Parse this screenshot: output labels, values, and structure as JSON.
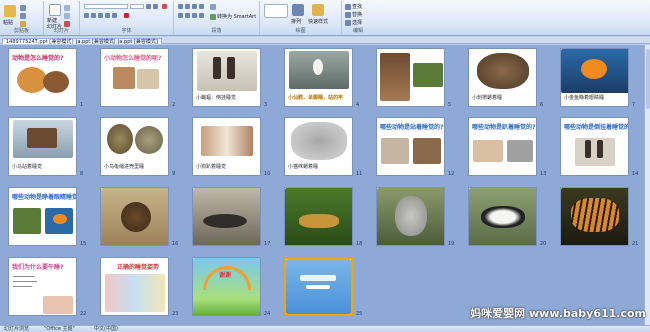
{
  "ribbon": {
    "paste_label": "粘贴",
    "clipboard_group": "剪贴板",
    "new_slide_label": "新建",
    "new_slide_sub": "幻灯片",
    "slides_group": "幻灯片",
    "font_group": "字体",
    "paragraph_group": "段落",
    "drawing_group": "绘图",
    "arrange_label": "排列",
    "quick_styles_label": "快速样式",
    "find_label": "查找",
    "replace_label": "替换",
    "select_label": "选择",
    "editing_group": "编辑",
    "smartart_label": "转换为 SmartArt"
  },
  "tabs": [
    {
      "label": "1489775247.ppt [兼容模式]",
      "selected": true
    },
    {
      "label": "ja.ppt [兼容模式]",
      "selected": false
    },
    {
      "label": "ja.ppt [兼容模式]",
      "selected": false
    }
  ],
  "slides": [
    {
      "num": "1",
      "title": "动物是怎么睡觉的?",
      "caption": ""
    },
    {
      "num": "2",
      "title": "小动物怎么睡觉的呢?",
      "caption": ""
    },
    {
      "num": "3",
      "title": "",
      "caption": "小蝙蝠：倒挂睡觉"
    },
    {
      "num": "4",
      "title": "",
      "caption": "小仙鹤，单脚睡，站的牢"
    },
    {
      "num": "5",
      "title": "",
      "caption": ""
    },
    {
      "num": "6",
      "title": "",
      "caption": "小刺猬蜷着睡"
    },
    {
      "num": "7",
      "title": "",
      "caption": "小金鱼睁着眼睛睡"
    },
    {
      "num": "8",
      "title": "",
      "caption": "小马站着睡觉"
    },
    {
      "num": "9",
      "title": "",
      "caption": "小乌龟缩进壳里睡"
    },
    {
      "num": "10",
      "title": "",
      "caption": "小狗趴着睡觉"
    },
    {
      "num": "11",
      "title": "",
      "caption": "小猫咪蜷着睡"
    },
    {
      "num": "12",
      "title": "哪些动物是站着睡觉的?",
      "caption": ""
    },
    {
      "num": "13",
      "title": "哪些动物是趴着睡觉的?",
      "caption": ""
    },
    {
      "num": "14",
      "title": "哪些动物是倒挂着睡觉的?",
      "caption": ""
    },
    {
      "num": "15",
      "title": "哪些动物是睁着眼睛睡觉的?",
      "caption": ""
    },
    {
      "num": "16",
      "title": "",
      "caption": ""
    },
    {
      "num": "17",
      "title": "",
      "caption": ""
    },
    {
      "num": "18",
      "title": "",
      "caption": ""
    },
    {
      "num": "19",
      "title": "",
      "caption": ""
    },
    {
      "num": "20",
      "title": "",
      "caption": ""
    },
    {
      "num": "21",
      "title": "",
      "caption": ""
    },
    {
      "num": "22",
      "title": "我们为什么要午睡?",
      "caption": ""
    },
    {
      "num": "23",
      "title": "正确的睡觉姿势",
      "caption": ""
    },
    {
      "num": "24",
      "title": "谢谢",
      "caption": ""
    },
    {
      "num": "25",
      "title": "",
      "caption": ""
    }
  ],
  "status": {
    "left": "幻灯片浏览",
    "theme": "\"Office 主题\"",
    "lang": "中文(中国)"
  },
  "watermark": "妈咪爱婴网 www.baby611.com",
  "colors": {
    "sorter_bg": "#8fa9d6",
    "current_border": "#f2a500",
    "title_pink": "#d23a7a",
    "title_blue": "#2e6bc2"
  }
}
